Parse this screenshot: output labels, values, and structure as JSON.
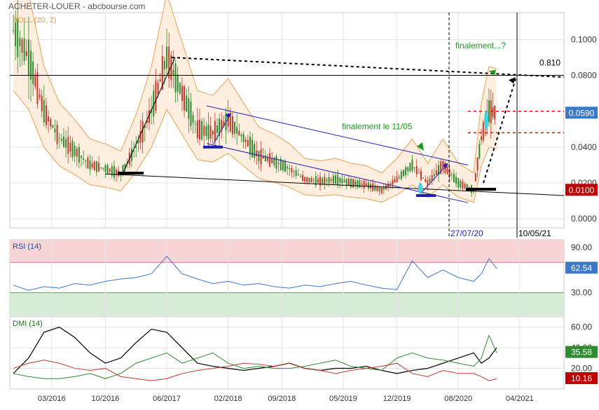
{
  "header": {
    "title": "ACHETER-LOUER - abcbourse.com"
  },
  "colors": {
    "price_up": "#2e8b2e",
    "price_down": "#c0392b",
    "bollinger": "#f0a050",
    "bollinger_fill": "#fdeee0",
    "rsi_line": "#3a78c8",
    "rsi_upper_zone": "#f7d4d6",
    "rsi_lower_zone": "#d6ecd6",
    "dmi_adx": "#111111",
    "dmi_plus": "#2e8b2e",
    "dmi_minus": "#c0392b",
    "annotation_green": "#1a9a1a",
    "trend_blue": "#2020b0",
    "red_dashed": "#e01010",
    "badge_blue": "#3a78c8",
    "badge_red": "#c00000",
    "badge_green": "#2e8b2e",
    "grid": "#e3e3e3"
  },
  "chart_data": [
    {
      "type": "candlestick",
      "name": "price",
      "title": "ACHETER-LOUER",
      "indicator_label": "BOLL (20, 2)",
      "x_tick_labels": [
        "03/2016",
        "10/2016",
        "06/2017",
        "02/2018",
        "09/2018",
        "05/2019",
        "12/2019",
        "08/2020",
        "04/2021"
      ],
      "y_ticks": [
        "0.1000",
        "0.0800",
        "0.0600",
        "0.0400",
        "0.0200",
        "0.0000"
      ],
      "ylim": [
        -0.005,
        0.115
      ],
      "last_close": "0.0590",
      "close_approx": {
        "dates": [
          "2015-10",
          "2015-12",
          "2016-02",
          "2016-04",
          "2016-06",
          "2016-08",
          "2016-10",
          "2016-12",
          "2017-02",
          "2017-04",
          "2017-06",
          "2017-08",
          "2017-10",
          "2017-12",
          "2018-02",
          "2018-04",
          "2018-06",
          "2018-08",
          "2018-10",
          "2018-12",
          "2019-02",
          "2019-04",
          "2019-06",
          "2019-08",
          "2019-10",
          "2019-12",
          "2020-02",
          "2020-04",
          "2020-06",
          "2020-08",
          "2020-10",
          "2020-11",
          "2020-12",
          "2021-01"
        ],
        "values": [
          0.105,
          0.09,
          0.06,
          0.045,
          0.038,
          0.03,
          0.028,
          0.025,
          0.04,
          0.06,
          0.09,
          0.07,
          0.05,
          0.048,
          0.055,
          0.045,
          0.035,
          0.032,
          0.028,
          0.022,
          0.021,
          0.022,
          0.02,
          0.019,
          0.016,
          0.022,
          0.03,
          0.02,
          0.03,
          0.02,
          0.016,
          0.045,
          0.06,
          0.059
        ]
      },
      "levels": [
        {
          "label": "0.810",
          "value": 0.08,
          "style": "solid-black"
        },
        {
          "label": "",
          "value": 0.06,
          "style": "dashed-red"
        },
        {
          "label": "",
          "value": 0.048,
          "style": "dashed-red"
        },
        {
          "label": "0.0100",
          "value": 0.016,
          "style": "red-badge"
        }
      ],
      "annotations": [
        {
          "text": "finalement le 11/05",
          "color": "green"
        },
        {
          "text": "finalement...?",
          "color": "green"
        },
        {
          "text": "27/07/20",
          "color": "blue",
          "kind": "vertical-dashed-line"
        },
        {
          "text": "10/05/21",
          "color": "blue",
          "kind": "vertical-line"
        }
      ]
    },
    {
      "type": "line",
      "name": "rsi",
      "indicator_label": "RSI (14)",
      "y_ticks": [
        "90.00",
        "60.00",
        "30.00"
      ],
      "ylim": [
        0,
        100
      ],
      "overbought": 70,
      "oversold": 30,
      "last_value": "62.54",
      "values_approx": [
        40,
        33,
        38,
        36,
        42,
        40,
        45,
        48,
        50,
        55,
        78,
        55,
        48,
        42,
        45,
        40,
        42,
        38,
        36,
        40,
        38,
        42,
        45,
        40,
        36,
        34,
        72,
        50,
        60,
        50,
        45,
        55,
        75,
        62
      ]
    },
    {
      "type": "line",
      "name": "dmi",
      "indicator_label": "DMI (14)",
      "y_ticks": [
        "60.00",
        "40.00",
        "20.00"
      ],
      "ylim": [
        0,
        70
      ],
      "last_values": {
        "plus": "35.58",
        "minus": "10.16"
      },
      "series": [
        {
          "values_approx": [
            15,
            30,
            55,
            60,
            50,
            35,
            25,
            30,
            45,
            58,
            55,
            40,
            25,
            22,
            20,
            18,
            20,
            22,
            25,
            20,
            18,
            20,
            20,
            22,
            18,
            15,
            18,
            20,
            25,
            30,
            35,
            25,
            30,
            40
          ]
        },
        {
          "values_approx": [
            15,
            12,
            10,
            10,
            12,
            15,
            10,
            15,
            25,
            30,
            35,
            25,
            30,
            35,
            25,
            20,
            22,
            20,
            20,
            22,
            25,
            28,
            22,
            20,
            18,
            30,
            35,
            30,
            28,
            25,
            22,
            30,
            52,
            35
          ]
        },
        {
          "values_approx": [
            20,
            25,
            28,
            25,
            20,
            18,
            20,
            12,
            10,
            8,
            10,
            15,
            18,
            20,
            22,
            25,
            24,
            22,
            25,
            20,
            18,
            15,
            18,
            20,
            22,
            25,
            15,
            12,
            18,
            15,
            15,
            12,
            8,
            10
          ]
        }
      ]
    }
  ]
}
